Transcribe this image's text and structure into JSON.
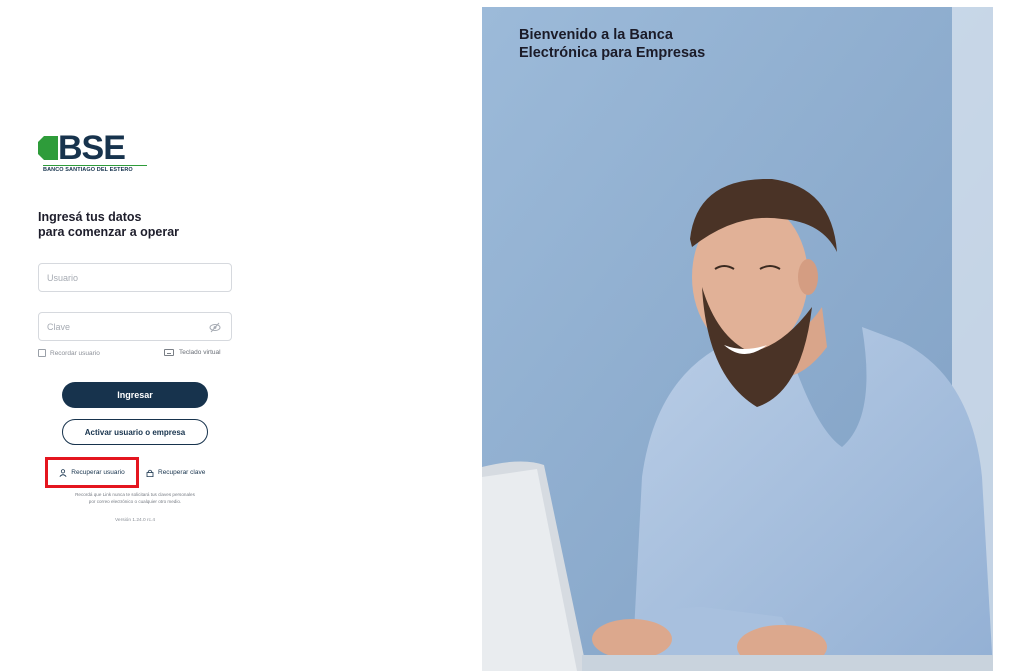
{
  "brand": {
    "logo_text": "BSE",
    "logo_subtitle": "BANCO SANTIAGO DEL ESTERO",
    "colors": {
      "navy": "#17334d",
      "green": "#2e9c3a",
      "highlight_red": "#e4151f"
    }
  },
  "login": {
    "heading_line1": "Ingresá tus datos",
    "heading_line2": "para comenzar a operar",
    "user_placeholder": "Usuario",
    "password_placeholder": "Clave",
    "remember_label": "Recordar usuario",
    "keyboard_label": "Teclado virtual",
    "submit_label": "Ingresar",
    "activate_label": "Activar usuario o empresa",
    "recover_user_label": "Recuperar usuario",
    "recover_password_label": "Recuperar clave",
    "notice_line1": "Recordá que Link nunca te solicitará tus claves personales",
    "notice_line2": "por correo electrónico o cualquier otro medio.",
    "version": "Versión 1.24.0 rc.4"
  },
  "hero": {
    "title_line1": "Bienvenido a la Banca",
    "title_line2": "Electrónica para Empresas"
  },
  "icons": {
    "eye": "eye-off-icon",
    "keyboard": "keyboard-icon",
    "recover_user": "person-icon",
    "recover_password": "lock-icon"
  }
}
